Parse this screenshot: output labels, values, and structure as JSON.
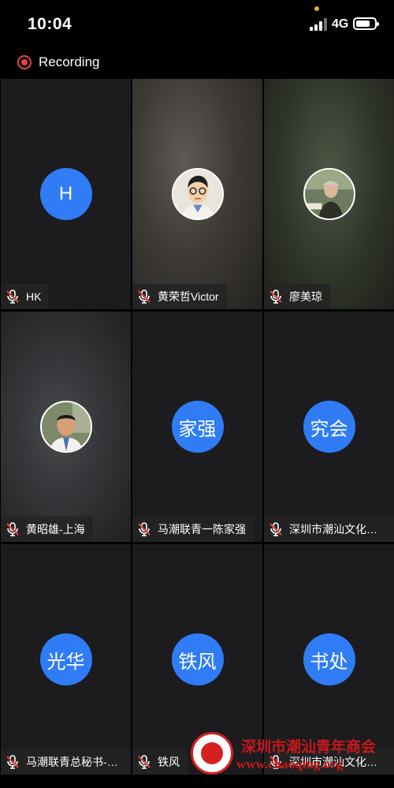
{
  "status_bar": {
    "time": "10:04",
    "network": "4G",
    "battery_level": 0.75
  },
  "recording": {
    "label": "Recording",
    "color": "#e5463f"
  },
  "accent_color": "#2f7cf6",
  "participants": [
    {
      "avatar": "H",
      "name": "HK",
      "muted": true
    },
    {
      "avatar": "cartoon-portrait",
      "name": "黄荣哲Victor",
      "muted": true
    },
    {
      "avatar": "photo-portrait",
      "name": "廖美琼",
      "muted": true
    },
    {
      "avatar": "photo-portrait",
      "name": "黄昭雄-上海",
      "muted": true
    },
    {
      "avatar": "家强",
      "name": "马潮联青一陈家强",
      "muted": true
    },
    {
      "avatar": "究会",
      "name": "深圳市潮汕文化研…",
      "muted": true
    },
    {
      "avatar": "光华",
      "name": "马潮联青总秘书-陈…",
      "muted": true
    },
    {
      "avatar": "铁风",
      "name": "铁风",
      "muted": true
    },
    {
      "avatar": "书处",
      "name": "深圳市潮汕文化研…",
      "muted": true
    }
  ],
  "watermark": {
    "title": "深圳市潮汕青年商会",
    "url": "www.chaoqing.org"
  }
}
